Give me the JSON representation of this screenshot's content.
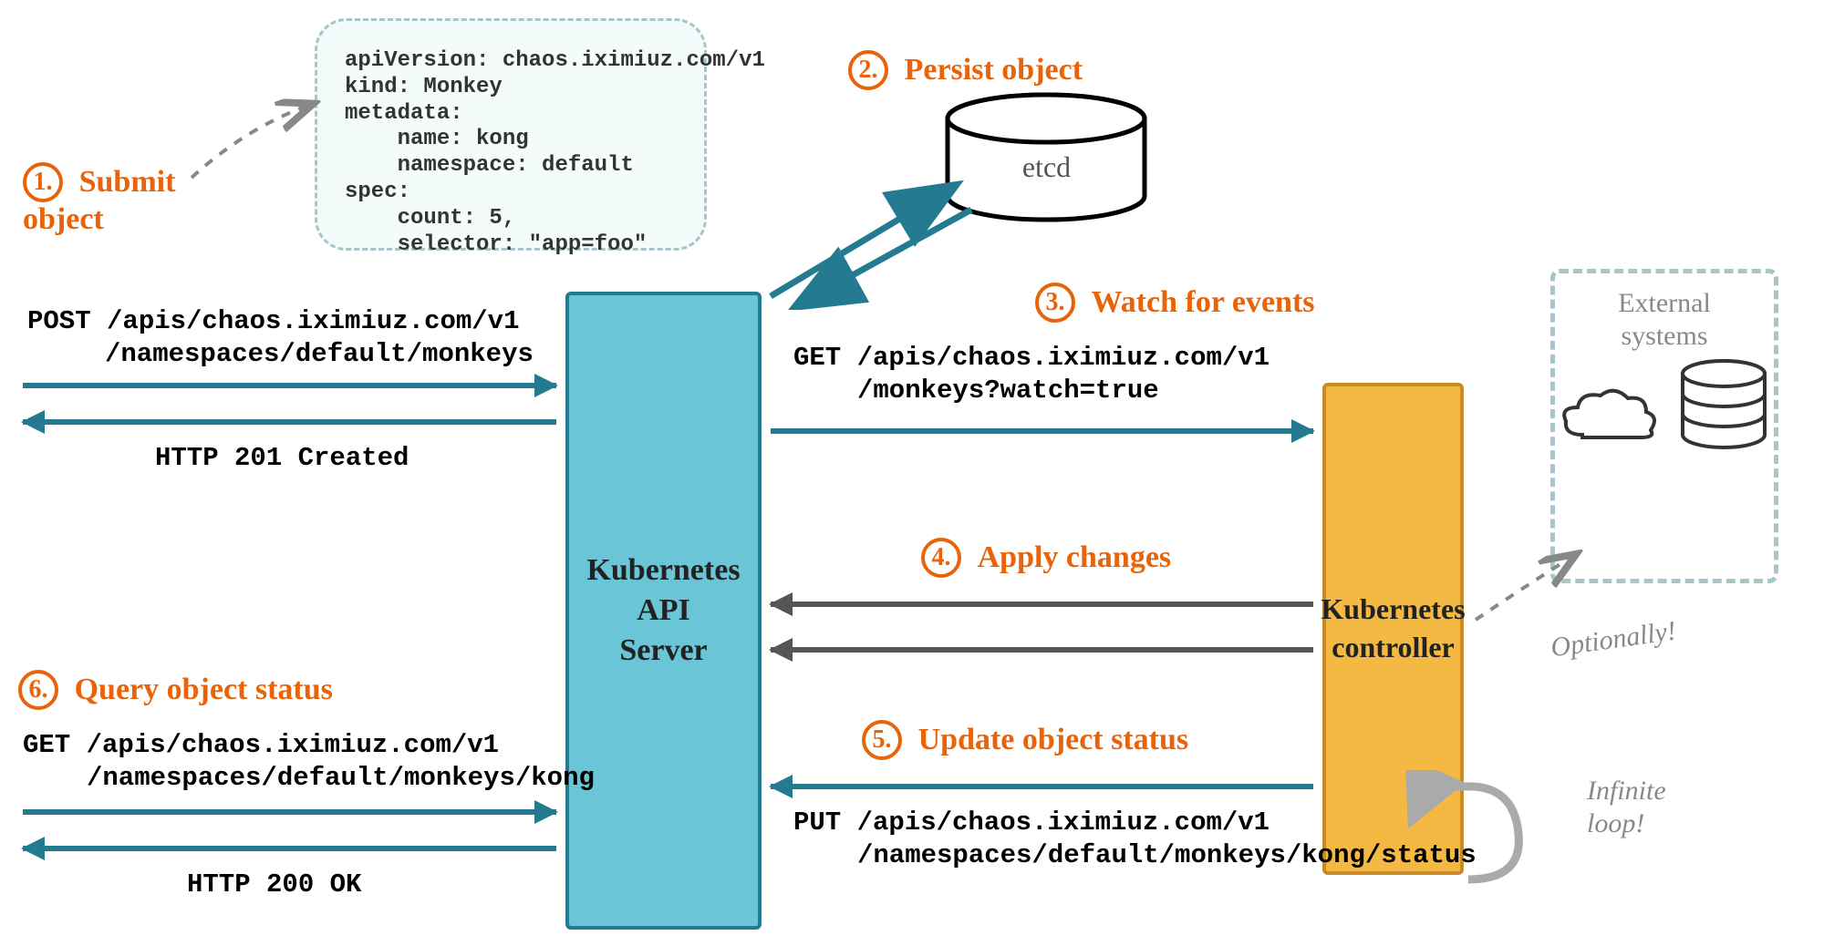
{
  "steps": {
    "s1": {
      "num": "1.",
      "label": "Submit object"
    },
    "s2": {
      "num": "2.",
      "label": "Persist object"
    },
    "s3": {
      "num": "3.",
      "label": "Watch for events"
    },
    "s4": {
      "num": "4.",
      "label": "Apply changes"
    },
    "s5": {
      "num": "5.",
      "label": "Update object status"
    },
    "s6": {
      "num": "6.",
      "label": "Query object status"
    }
  },
  "yaml": "apiVersion: chaos.iximiuz.com/v1\nkind: Monkey\nmetadata:\n    name: kong\n    namespace: default\nspec:\n    count: 5,\n    selector: \"app=foo\"",
  "boxes": {
    "api_server": "Kubernetes\nAPI\nServer",
    "controller": "Kubernetes\ncontroller",
    "etcd": "etcd",
    "external": "External\nsystems"
  },
  "requests": {
    "post_line1": "POST /apis/chaos.iximiuz.com/v1",
    "post_line2": "/namespaces/default/monkeys",
    "resp_201": "HTTP 201 Created",
    "get_watch_line1": "GET /apis/chaos.iximiuz.com/v1",
    "get_watch_line2": "/monkeys?watch=true",
    "get_status_line1": "GET /apis/chaos.iximiuz.com/v1",
    "get_status_line2": "/namespaces/default/monkeys/kong",
    "resp_200": "HTTP 200 OK",
    "put_line1": "PUT /apis/chaos.iximiuz.com/v1",
    "put_line2": "/namespaces/default/monkeys/kong/status"
  },
  "notes": {
    "optionally": "Optionally!",
    "infinite": "Infinite\nloop!"
  }
}
